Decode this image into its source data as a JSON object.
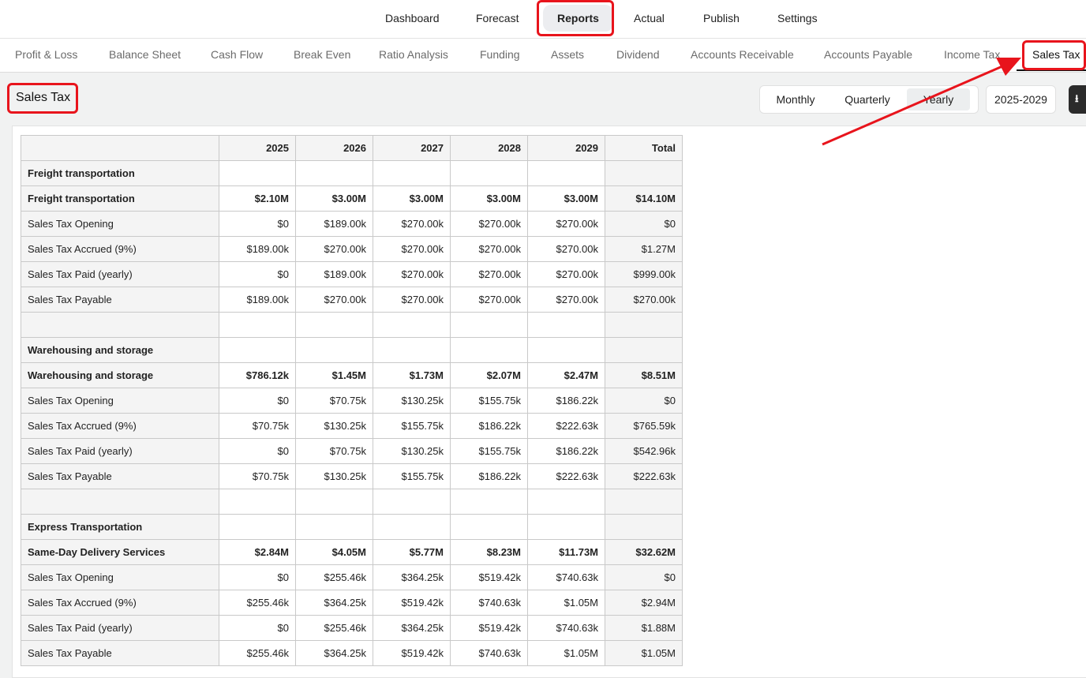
{
  "top_nav": [
    {
      "label": "Dashboard",
      "active": false
    },
    {
      "label": "Forecast",
      "active": false
    },
    {
      "label": "Reports",
      "active": true
    },
    {
      "label": "Actual",
      "active": false
    },
    {
      "label": "Publish",
      "active": false
    },
    {
      "label": "Settings",
      "active": false
    }
  ],
  "sub_nav": [
    {
      "label": "Profit & Loss",
      "active": false
    },
    {
      "label": "Balance Sheet",
      "active": false
    },
    {
      "label": "Cash Flow",
      "active": false
    },
    {
      "label": "Break Even",
      "active": false
    },
    {
      "label": "Ratio Analysis",
      "active": false
    },
    {
      "label": "Funding",
      "active": false
    },
    {
      "label": "Assets",
      "active": false
    },
    {
      "label": "Dividend",
      "active": false
    },
    {
      "label": "Accounts Receivable",
      "active": false
    },
    {
      "label": "Accounts Payable",
      "active": false
    },
    {
      "label": "Income Tax",
      "active": false
    },
    {
      "label": "Sales Tax",
      "active": true
    }
  ],
  "page_title": "Sales Tax",
  "period_toggle": {
    "options": [
      "Monthly",
      "Quarterly",
      "Yearly"
    ],
    "selected": "Yearly"
  },
  "range": "2025-2029",
  "download_icon": "download-icon",
  "annotation_color": "#e8141c",
  "table": {
    "headers": [
      "",
      "2025",
      "2026",
      "2027",
      "2028",
      "2029",
      "Total"
    ],
    "rows": [
      {
        "cells": [
          "Freight transportation",
          "",
          "",
          "",
          "",
          "",
          ""
        ],
        "bold": true
      },
      {
        "cells": [
          "Freight transportation",
          "$2.10M",
          "$3.00M",
          "$3.00M",
          "$3.00M",
          "$3.00M",
          "$14.10M"
        ],
        "bold": true
      },
      {
        "cells": [
          "Sales Tax Opening",
          "$0",
          "$189.00k",
          "$270.00k",
          "$270.00k",
          "$270.00k",
          "$0"
        ],
        "bold": false
      },
      {
        "cells": [
          "Sales Tax Accrued (9%)",
          "$189.00k",
          "$270.00k",
          "$270.00k",
          "$270.00k",
          "$270.00k",
          "$1.27M"
        ],
        "bold": false
      },
      {
        "cells": [
          "Sales Tax Paid (yearly)",
          "$0",
          "$189.00k",
          "$270.00k",
          "$270.00k",
          "$270.00k",
          "$999.00k"
        ],
        "bold": false
      },
      {
        "cells": [
          "Sales Tax Payable",
          "$189.00k",
          "$270.00k",
          "$270.00k",
          "$270.00k",
          "$270.00k",
          "$270.00k"
        ],
        "bold": false
      },
      {
        "cells": [
          "",
          "",
          "",
          "",
          "",
          "",
          ""
        ],
        "bold": false
      },
      {
        "cells": [
          "Warehousing and storage",
          "",
          "",
          "",
          "",
          "",
          ""
        ],
        "bold": true
      },
      {
        "cells": [
          "Warehousing and storage",
          "$786.12k",
          "$1.45M",
          "$1.73M",
          "$2.07M",
          "$2.47M",
          "$8.51M"
        ],
        "bold": true
      },
      {
        "cells": [
          "Sales Tax Opening",
          "$0",
          "$70.75k",
          "$130.25k",
          "$155.75k",
          "$186.22k",
          "$0"
        ],
        "bold": false
      },
      {
        "cells": [
          "Sales Tax Accrued (9%)",
          "$70.75k",
          "$130.25k",
          "$155.75k",
          "$186.22k",
          "$222.63k",
          "$765.59k"
        ],
        "bold": false
      },
      {
        "cells": [
          "Sales Tax Paid (yearly)",
          "$0",
          "$70.75k",
          "$130.25k",
          "$155.75k",
          "$186.22k",
          "$542.96k"
        ],
        "bold": false
      },
      {
        "cells": [
          "Sales Tax Payable",
          "$70.75k",
          "$130.25k",
          "$155.75k",
          "$186.22k",
          "$222.63k",
          "$222.63k"
        ],
        "bold": false
      },
      {
        "cells": [
          "",
          "",
          "",
          "",
          "",
          "",
          ""
        ],
        "bold": false
      },
      {
        "cells": [
          "Express Transportation",
          "",
          "",
          "",
          "",
          "",
          ""
        ],
        "bold": true
      },
      {
        "cells": [
          "Same-Day Delivery Services",
          "$2.84M",
          "$4.05M",
          "$5.77M",
          "$8.23M",
          "$11.73M",
          "$32.62M"
        ],
        "bold": true
      },
      {
        "cells": [
          "Sales Tax Opening",
          "$0",
          "$255.46k",
          "$364.25k",
          "$519.42k",
          "$740.63k",
          "$0"
        ],
        "bold": false
      },
      {
        "cells": [
          "Sales Tax Accrued (9%)",
          "$255.46k",
          "$364.25k",
          "$519.42k",
          "$740.63k",
          "$1.05M",
          "$2.94M"
        ],
        "bold": false
      },
      {
        "cells": [
          "Sales Tax Paid (yearly)",
          "$0",
          "$255.46k",
          "$364.25k",
          "$519.42k",
          "$740.63k",
          "$1.88M"
        ],
        "bold": false
      },
      {
        "cells": [
          "Sales Tax Payable",
          "$255.46k",
          "$364.25k",
          "$519.42k",
          "$740.63k",
          "$1.05M",
          "$1.05M"
        ],
        "bold": false
      }
    ]
  }
}
